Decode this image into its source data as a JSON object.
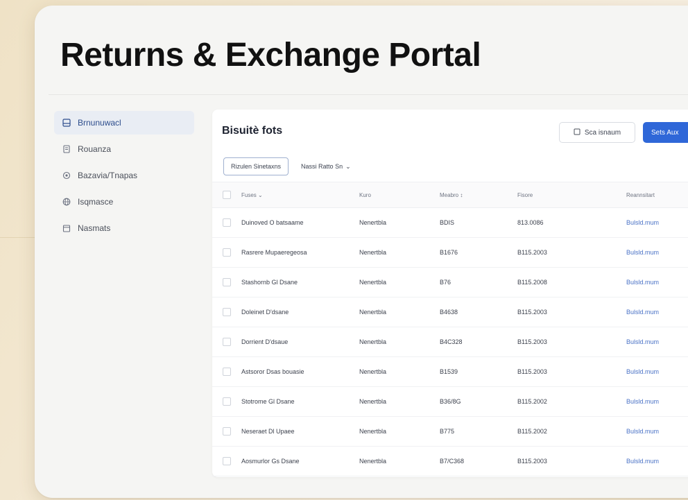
{
  "page": {
    "title": "Returns & Exchange Portal"
  },
  "sidebar": {
    "items": [
      {
        "label": "Brnunuwacl",
        "icon": "inbox-icon",
        "active": true
      },
      {
        "label": "Rouanza",
        "icon": "document-icon",
        "active": false
      },
      {
        "label": "Bazavia/Tnapas",
        "icon": "settings-icon",
        "active": false
      },
      {
        "label": "Isqmasce",
        "icon": "globe-icon",
        "active": false
      },
      {
        "label": "Nasmats",
        "icon": "calendar-icon",
        "active": false
      }
    ]
  },
  "panel": {
    "title": "Bisuitè fots",
    "secondary_button": "Sca isnaum",
    "primary_button": "Sets Aux",
    "tabs": [
      {
        "label": "Rizulen Sinetaxns",
        "active": true
      },
      {
        "label": "Nassi Ratto Sn",
        "active": false
      }
    ]
  },
  "table": {
    "headers": [
      "Fuses",
      "Kuro",
      "Meabro",
      "Fisore",
      "Reannsitart"
    ],
    "rows": [
      [
        "Duinoved O batsaame",
        "Nenertbla",
        "BDIS",
        "813.0086",
        "Bulsld.mum"
      ],
      [
        "Rasrere Mupaeregeosa",
        "Nenertbla",
        "B1676",
        "B115.2003",
        "Bulsld.mum"
      ],
      [
        "Stashornb Gl Dsane",
        "Nenertbla",
        "B76",
        "B115.2008",
        "Bulsld.mum"
      ],
      [
        "Doleinet D'dsane",
        "Nenertbla",
        "B4638",
        "B115.2003",
        "Bulsld.mum"
      ],
      [
        "Dorrient D'dsaue",
        "Nenertbla",
        "B4C328",
        "B115.2003",
        "Bulsld.mum"
      ],
      [
        "Astsoror Dsas bouasie",
        "Nenertbla",
        "B1539",
        "B115.2003",
        "Bulsld.mum"
      ],
      [
        "Stotrome Gl Dsane",
        "Nenertbla",
        "B36/8G",
        "B115.2002",
        "Bulsld.mum"
      ],
      [
        "Neseraet Dl Upaee",
        "Nenertbla",
        "B775",
        "B115.2002",
        "Bulsld.mum"
      ],
      [
        "Aosmurlor Gs Dsane",
        "Nenertbla",
        "B7/C368",
        "B115.2003",
        "Bulsld.mum"
      ]
    ]
  }
}
